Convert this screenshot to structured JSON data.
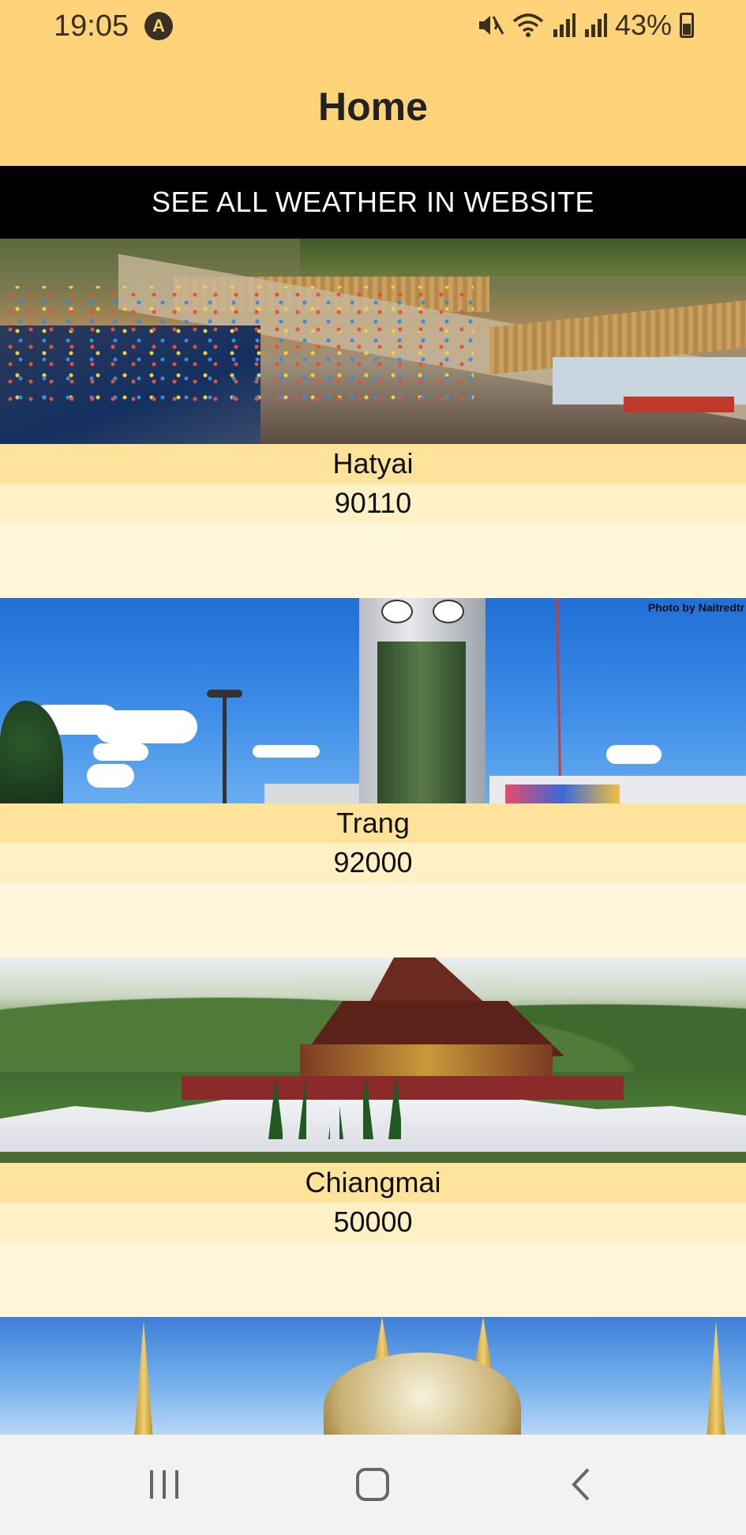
{
  "status_bar": {
    "time": "19:05",
    "notification_icon": "a-circle-icon",
    "battery": "43%",
    "icons": [
      "mute-icon",
      "wifi-icon",
      "signal-icon",
      "signal-icon",
      "battery-icon"
    ]
  },
  "header": {
    "title": "Home"
  },
  "website_button": {
    "label": "SEE ALL WEATHER IN WEBSITE"
  },
  "cities": [
    {
      "name": "Hatyai",
      "postcode": "90110",
      "image": "floating-market-photo"
    },
    {
      "name": "Trang",
      "postcode": "92000",
      "image": "clock-tower-photo",
      "photo_credit": "Photo by Naitredtr"
    },
    {
      "name": "Chiangmai",
      "postcode": "50000",
      "image": "royal-pavilion-photo"
    },
    {
      "name": "",
      "postcode": "",
      "image": "golden-temple-photo"
    }
  ],
  "nav_bar": {
    "recents_icon": "recents-icon",
    "home_icon": "home-icon",
    "back_icon": "back-icon"
  },
  "colors": {
    "header_bg": "#ffd37a",
    "button_bg": "#000000",
    "name_bg": "#ffe39a",
    "postcode_bg": "#fff0c6",
    "card_bg": "#fff6dc"
  }
}
